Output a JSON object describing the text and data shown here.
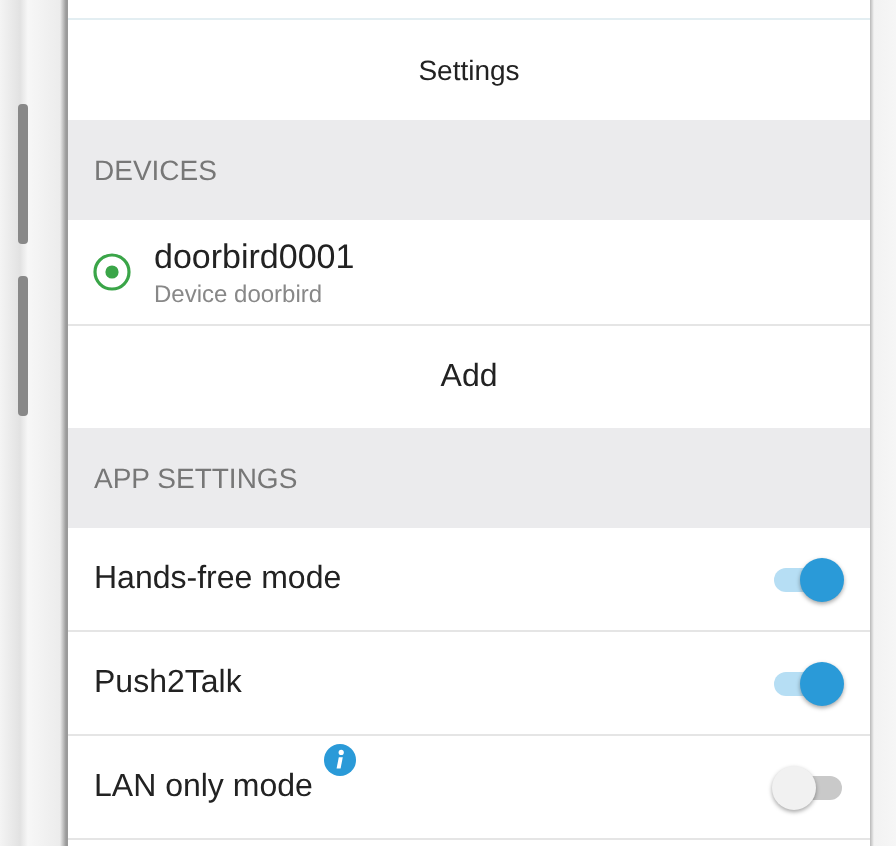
{
  "header": {
    "title": "Settings"
  },
  "devices": {
    "heading": "DEVICES",
    "items": [
      {
        "name": "doorbird0001",
        "subtitle": "Device doorbird",
        "selected": true
      }
    ],
    "add_label": "Add"
  },
  "app_settings": {
    "heading": "APP SETTINGS",
    "items": [
      {
        "label": "Hands-free mode",
        "on": true,
        "info": false
      },
      {
        "label": "Push2Talk",
        "on": true,
        "info": false
      },
      {
        "label": "LAN only mode",
        "on": false,
        "info": true
      }
    ]
  }
}
